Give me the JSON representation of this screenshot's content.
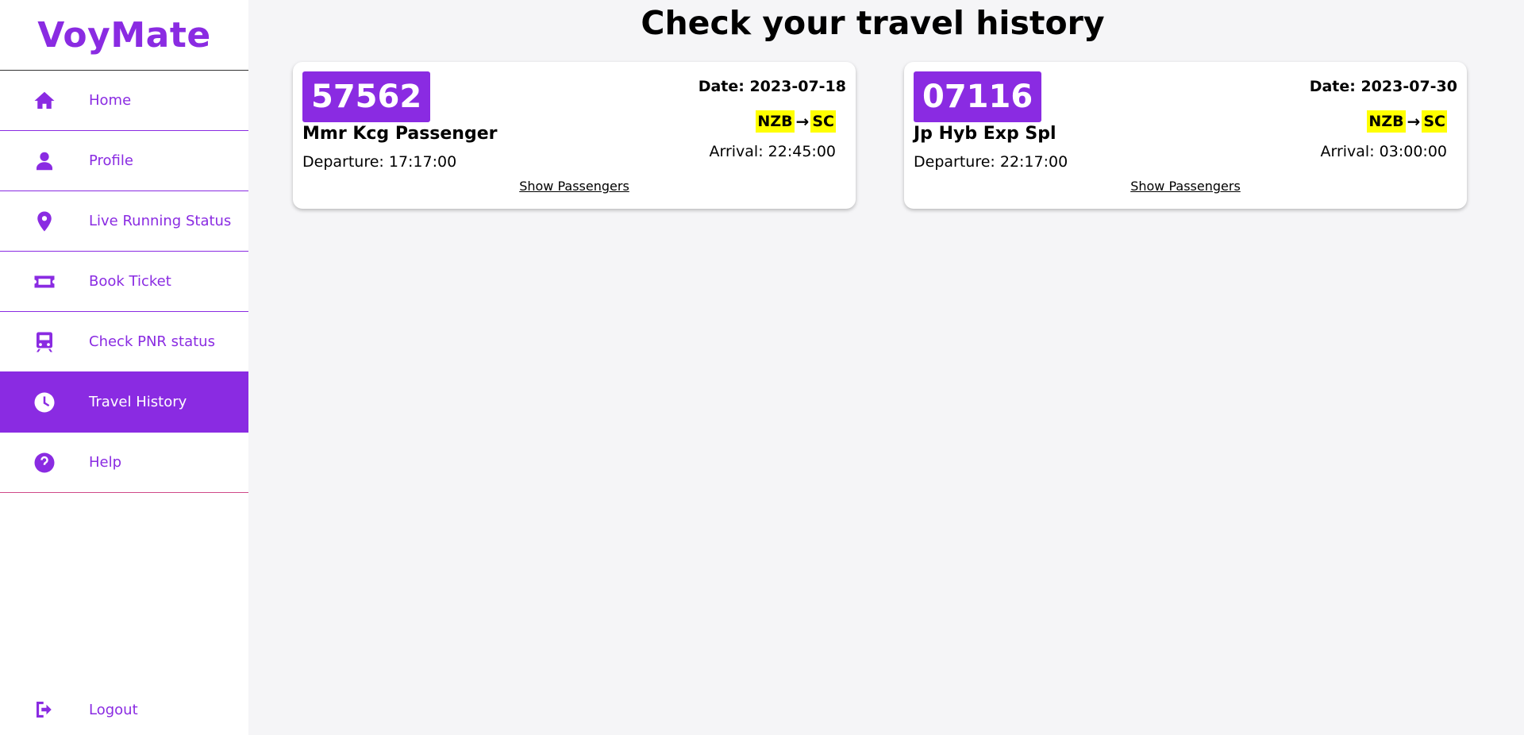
{
  "brand": "VoyMate",
  "accent_color": "#8a2be2",
  "highlight_color": "#ffff00",
  "sidebar": {
    "items": [
      {
        "label": "Home",
        "icon": "home-icon"
      },
      {
        "label": "Profile",
        "icon": "person-icon"
      },
      {
        "label": "Live Running Status",
        "icon": "location-pin-icon"
      },
      {
        "label": "Book Ticket",
        "icon": "ticket-icon"
      },
      {
        "label": "Check PNR status",
        "icon": "train-icon"
      },
      {
        "label": "Travel History",
        "icon": "clock-icon",
        "active": true
      },
      {
        "label": "Help",
        "icon": "help-icon"
      }
    ],
    "logout": {
      "label": "Logout",
      "icon": "logout-icon"
    }
  },
  "main": {
    "title": "Check your travel history",
    "trips": [
      {
        "train_no": "57562",
        "train_name": "Mmr Kcg Passenger",
        "departure": "Departure: 17:17:00",
        "date": "Date: 2023-07-18",
        "from": "NZB",
        "arrow": "→",
        "to": "SC",
        "arrival": "Arrival: 22:45:00",
        "action": "Show Passengers"
      },
      {
        "train_no": "07116",
        "train_name": "Jp Hyb Exp Spl",
        "departure": "Departure: 22:17:00",
        "date": "Date: 2023-07-30",
        "from": "NZB",
        "arrow": "→",
        "to": "SC",
        "arrival": "Arrival: 03:00:00",
        "action": "Show Passengers"
      }
    ]
  }
}
